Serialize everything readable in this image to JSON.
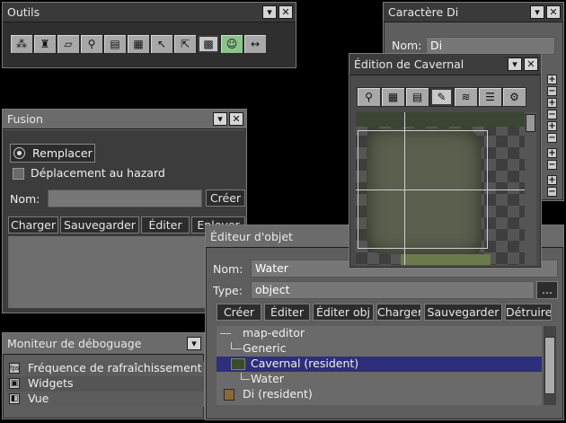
{
  "outils": {
    "title": "Outils",
    "tools": [
      "nodes-icon",
      "stamp-icon",
      "eraser-icon",
      "magnifier-icon",
      "layer-icon",
      "tile-grid-icon",
      "pointer-icon",
      "multi-pointer-icon",
      "grid-select-icon",
      "face-icon",
      "resize-arrows-icon"
    ]
  },
  "caractere": {
    "title": "Caractère Di",
    "nom_label": "Nom:",
    "nom_value": "Di"
  },
  "cavernal": {
    "title": "Édition de Cavernal",
    "tools": [
      "zoom-page-icon",
      "grid-icon",
      "tiles-icon",
      "pencil-icon",
      "layers-icon",
      "stack-icon",
      "settings-doc-icon"
    ]
  },
  "fusion": {
    "title": "Fusion",
    "radio_label": "Remplacer",
    "checkbox_label": "Déplacement au hazard",
    "nom_label": "Nom:",
    "nom_value": "",
    "create_label": "Créer",
    "buttons": [
      "Charger",
      "Sauvegarder",
      "Éditer",
      "Enlever"
    ]
  },
  "moniteur": {
    "title": "Moniteur de déboguage",
    "items": [
      {
        "icon": "fps-icon",
        "label": "Fréquence de rafraîchissement"
      },
      {
        "icon": "widgets-icon",
        "label": "Widgets"
      },
      {
        "icon": "view-icon",
        "label": "Vue"
      }
    ]
  },
  "editeur": {
    "title": "Éditeur d'objet",
    "nom_label": "Nom:",
    "nom_value": "Water",
    "type_label": "Type:",
    "type_value": "object",
    "browse_label": "...",
    "buttons": [
      "Créer",
      "Éditer",
      "Éditer obj",
      "Charger",
      "Sauvegarder",
      "Détruire"
    ],
    "tree": [
      {
        "label": "map-editor",
        "selected": false
      },
      {
        "label": "Generic",
        "selected": false
      },
      {
        "label": "Cavernal (resident)",
        "selected": true
      },
      {
        "label": "Water",
        "selected": false
      },
      {
        "label": "Di (resident)",
        "selected": false
      }
    ]
  },
  "colors": {
    "window_bg": "#5e5e5e",
    "title_bg": "#3a3a3a",
    "selection": "#2e2f7a",
    "button_bg": "#2c2c2c"
  }
}
